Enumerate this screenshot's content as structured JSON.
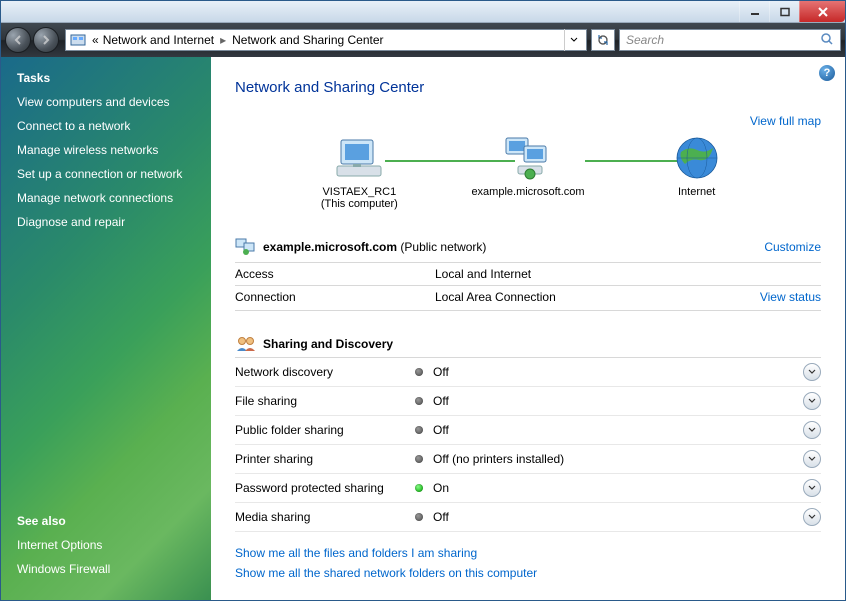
{
  "breadcrumb": {
    "left_chevrons": "«",
    "crumb1": "Network and Internet",
    "crumb2": "Network and Sharing Center"
  },
  "search": {
    "placeholder": "Search"
  },
  "sidebar": {
    "tasks_heading": "Tasks",
    "tasks": [
      "View computers and devices",
      "Connect to a network",
      "Manage wireless networks",
      "Set up a connection or network",
      "Manage network connections",
      "Diagnose and repair"
    ],
    "seealso_heading": "See also",
    "seealso": [
      "Internet Options",
      "Windows Firewall"
    ]
  },
  "main": {
    "title": "Network and Sharing Center",
    "view_full_map": "View full map",
    "nodes": {
      "computer_name": "VISTAEX_RC1",
      "computer_sub": "(This computer)",
      "network_name": "example.microsoft.com",
      "internet": "Internet"
    },
    "connection": {
      "header_name": "example.microsoft.com",
      "header_type": "(Public network)",
      "customize": "Customize",
      "rows": [
        {
          "label": "Access",
          "value": "Local and Internet",
          "link": ""
        },
        {
          "label": "Connection",
          "value": "Local Area Connection",
          "link": "View status"
        }
      ]
    },
    "sharing": {
      "title": "Sharing and Discovery",
      "rows": [
        {
          "label": "Network discovery",
          "status": "Off",
          "on": false
        },
        {
          "label": "File sharing",
          "status": "Off",
          "on": false
        },
        {
          "label": "Public folder sharing",
          "status": "Off",
          "on": false
        },
        {
          "label": "Printer sharing",
          "status": "Off (no printers installed)",
          "on": false
        },
        {
          "label": "Password protected sharing",
          "status": "On",
          "on": true
        },
        {
          "label": "Media sharing",
          "status": "Off",
          "on": false
        }
      ]
    },
    "bottom_links": [
      "Show me all the files and folders I am sharing",
      "Show me all the shared network folders on this computer"
    ]
  }
}
